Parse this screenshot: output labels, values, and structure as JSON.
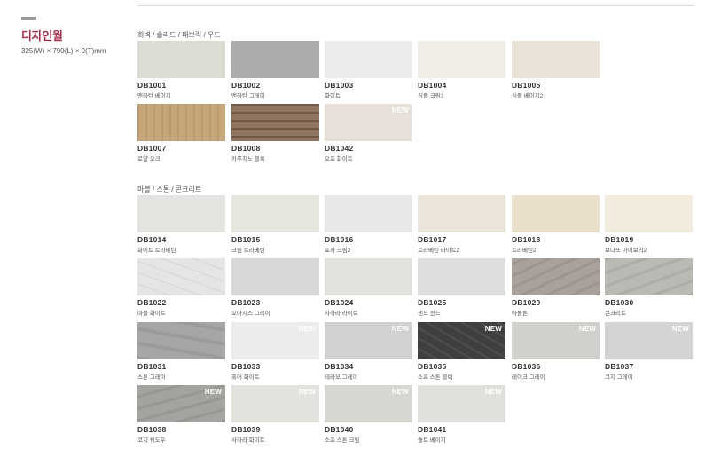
{
  "header": {
    "title": "디자인월",
    "dims": "325(W) × 790(L) × 9(T)mm"
  },
  "sections": [
    {
      "category": "회벽 / 솔리드 / 패브릭 / 우드",
      "items": [
        {
          "code": "DB1001",
          "name": "맨하탄 베이지",
          "color": "#dcdcd3",
          "isNew": false
        },
        {
          "code": "DB1002",
          "name": "맨하탄 그레이",
          "color": "#a8a9a8",
          "isNew": false
        },
        {
          "code": "DB1003",
          "name": "화이트",
          "color": "#ececea",
          "isNew": false
        },
        {
          "code": "DB1004",
          "name": "심플 크림3",
          "color": "#f1eee7",
          "isNew": false
        },
        {
          "code": "DB1005",
          "name": "심플 베이지2",
          "color": "#e9e2d6",
          "isNew": false
        },
        {
          "code": "DB1007",
          "name": "로얄 오크",
          "color": "#c4a67a",
          "isNew": false
        },
        {
          "code": "DB1008",
          "name": "카푸치노 블록",
          "color": "#8e7560",
          "isNew": false
        },
        {
          "code": "DB1042",
          "name": "오프 화이트",
          "color": "#e6e0d9",
          "isNew": true
        }
      ]
    },
    {
      "category": "마블 / 스톤 / 콘크리트",
      "items": [
        {
          "code": "DB1014",
          "name": "화이트 트라베틴",
          "color": "#e3e3df",
          "isNew": false
        },
        {
          "code": "DB1015",
          "name": "크림 트라베틴",
          "color": "#e6e6de",
          "isNew": false
        },
        {
          "code": "DB1016",
          "name": "포카 크림2",
          "color": "#e8e8e6",
          "isNew": false
        },
        {
          "code": "DB1017",
          "name": "트라베틴 라이트2",
          "color": "#ebe5d9",
          "isNew": false
        },
        {
          "code": "DB1018",
          "name": "트라베틴2",
          "color": "#e9dfca",
          "isNew": false
        },
        {
          "code": "DB1019",
          "name": "보나또 아이보리2",
          "color": "#f1ecdd",
          "isNew": false
        },
        {
          "code": "DB1022",
          "name": "마블 화이트",
          "color": "#e5e5e3",
          "isNew": false
        },
        {
          "code": "DB1023",
          "name": "오아시스 그레이",
          "color": "#d8d9d7",
          "isNew": false
        },
        {
          "code": "DB1024",
          "name": "사하라 라이트",
          "color": "#e2e1dd",
          "isNew": false
        },
        {
          "code": "DB1025",
          "name": "샌드 윈드",
          "color": "#dddddb",
          "isNew": false
        },
        {
          "code": "DB1029",
          "name": "아돌론",
          "color": "#a9a19a",
          "isNew": false
        },
        {
          "code": "DB1030",
          "name": "콘크리트",
          "color": "#b9bab3",
          "isNew": false
        },
        {
          "code": "DB1031",
          "name": "스톤 그레이",
          "color": "#a5a7a5",
          "isNew": false
        },
        {
          "code": "DB1033",
          "name": "퓨어 화이트",
          "color": "#ececeb",
          "isNew": true
        },
        {
          "code": "DB1034",
          "name": "테라모 그레이",
          "color": "#d2d1cf",
          "isNew": true
        },
        {
          "code": "DB1035",
          "name": "소프 스톤 블랙",
          "color": "#3e3f40",
          "isNew": true
        },
        {
          "code": "DB1036",
          "name": "레이크 그레이",
          "color": "#d2d0cd",
          "isNew": true
        },
        {
          "code": "DB1037",
          "name": "코지 그레이",
          "color": "#d3d4d3",
          "isNew": true
        },
        {
          "code": "DB1038",
          "name": "코지 쉐도우",
          "color": "#a3a49f",
          "isNew": true
        },
        {
          "code": "DB1039",
          "name": "사하라 화이트",
          "color": "#e3e3de",
          "isNew": true
        },
        {
          "code": "DB1040",
          "name": "소프 스톤 크림",
          "color": "#d7d7d2",
          "isNew": true
        },
        {
          "code": "DB1041",
          "name": "솔트 베이지",
          "color": "#e2e0dc",
          "isNew": true
        }
      ]
    }
  ],
  "newBadge": "NEW"
}
